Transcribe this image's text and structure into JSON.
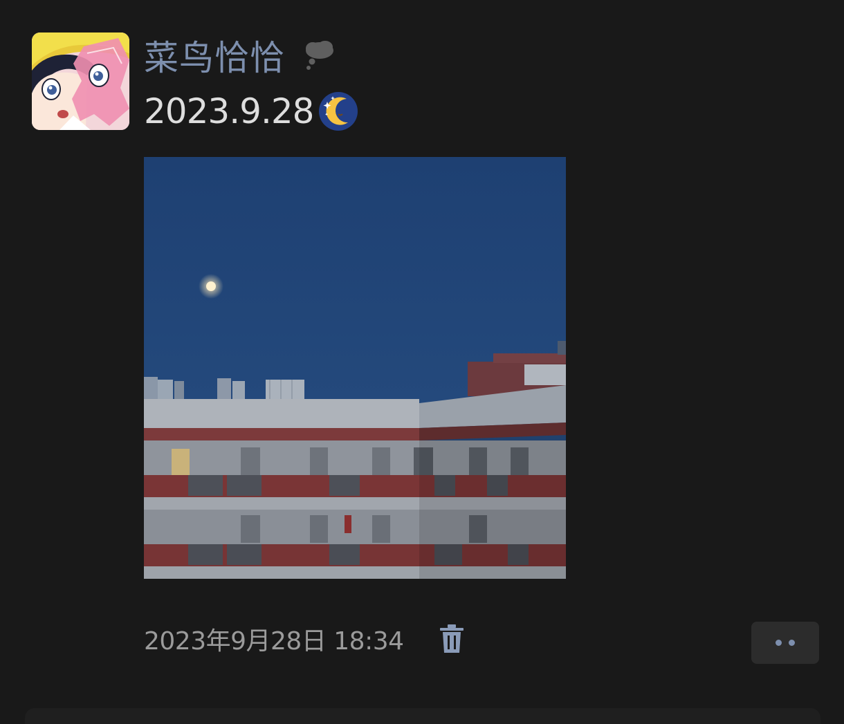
{
  "post": {
    "username": "菜鸟恰恰",
    "text": "2023.9.28",
    "timestamp": "2023年9月28日 18:34"
  },
  "icons": {
    "status": "thought-cloud-icon",
    "emoji": "crescent-moon-stars-emoji",
    "delete": "trash-icon",
    "more": "more-dots-icon"
  },
  "colors": {
    "background": "#191919",
    "username": "#7d8fae",
    "text": "#dedede",
    "timestamp": "#9b9b9b",
    "more_button_bg": "#2c2c2c",
    "accent": "#7d8fae"
  }
}
